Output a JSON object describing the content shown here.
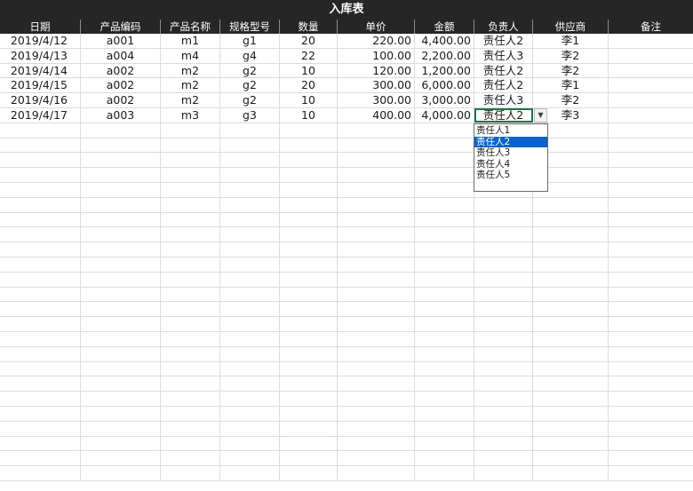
{
  "sheet": {
    "title": "入库表",
    "columns": [
      "日期",
      "产品编码",
      "产品名称",
      "规格型号",
      "数量",
      "单价",
      "金额",
      "负责人",
      "供应商",
      "备注"
    ],
    "rows": [
      [
        "2019/4/12",
        "a001",
        "m1",
        "g1",
        "20",
        "220.00",
        "4,400.00",
        "责任人2",
        "李1",
        ""
      ],
      [
        "2019/4/13",
        "a004",
        "m4",
        "g4",
        "22",
        "100.00",
        "2,200.00",
        "责任人3",
        "李2",
        ""
      ],
      [
        "2019/4/14",
        "a002",
        "m2",
        "g2",
        "10",
        "120.00",
        "1,200.00",
        "责任人2",
        "李2",
        ""
      ],
      [
        "2019/4/15",
        "a002",
        "m2",
        "g2",
        "20",
        "300.00",
        "6,000.00",
        "责任人2",
        "李1",
        ""
      ],
      [
        "2019/4/16",
        "a002",
        "m2",
        "g2",
        "10",
        "300.00",
        "3,000.00",
        "责任人3",
        "李2",
        ""
      ],
      [
        "2019/4/17",
        "a003",
        "m3",
        "g3",
        "10",
        "400.00",
        "4,000.00",
        "责任人2",
        "李3",
        ""
      ]
    ],
    "active_cell": {
      "row": 5,
      "column": "负责人",
      "value": "责任人2"
    }
  },
  "dropdown": {
    "arrow_icon": "chevron-down-icon",
    "options": [
      "责任人1",
      "责任人2",
      "责任人3",
      "责任人4",
      "责任人5"
    ],
    "selected": "责任人2"
  },
  "colors": {
    "header_bg": "#262626",
    "header_text": "#ffffff",
    "gridline": "#dcdcdc",
    "selection_border": "#217346",
    "dropdown_highlight": "#0a64c8"
  }
}
